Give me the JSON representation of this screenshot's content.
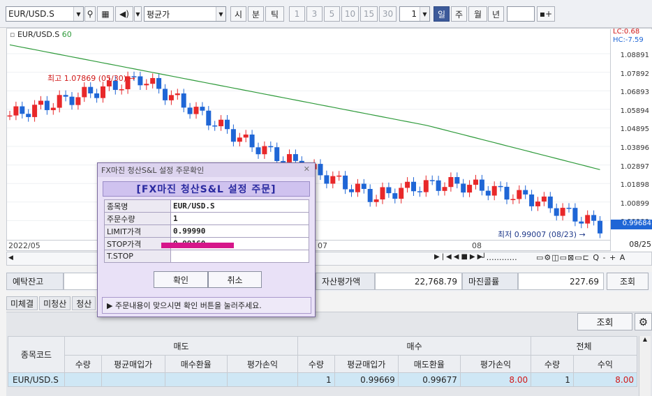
{
  "toolbar": {
    "symbol": "EUR/USD.S",
    "price_type": "평균가",
    "units": [
      "시",
      "분",
      "틱"
    ],
    "intervals": [
      "1",
      "3",
      "5",
      "10",
      "15",
      "30"
    ],
    "interval_count": "1",
    "periods": [
      "일",
      "주",
      "월",
      "년"
    ],
    "period_selected": "일"
  },
  "chart": {
    "legend_symbol": "EUR/USD.S",
    "legend_ma": "60",
    "high_label": "최고 1.07869 (05/30)",
    "low_label": "최저 0.99007 (08/23)",
    "lc": "LC:0.68",
    "hc": "HC:-7.59",
    "price_levels": [
      "1.08891",
      "1.07892",
      "1.06893",
      "1.05894",
      "1.04895",
      "1.03896",
      "1.02897",
      "1.01898",
      "1.00899",
      "0.99900"
    ],
    "current_price": "0.99684",
    "dates": [
      "2022/05",
      "07",
      "08",
      "08/25"
    ],
    "chart_data": {
      "type": "candlestick",
      "series": [
        {
          "name": "60"
        }
      ],
      "ylim": [
        0.99,
        1.09
      ]
    }
  },
  "summary": {
    "deposit_label": "예탁잔고",
    "asset_label": "자산평가액",
    "asset_value": "22,768.79",
    "margin_label": "마진콜률",
    "margin_value": "227.69",
    "query_button": "조회"
  },
  "tabs": [
    "미체결",
    "미청산",
    "청산"
  ],
  "query_button2": "조회",
  "table": {
    "col_code": "종목코드",
    "group_sell": "매도",
    "group_buy": "매수",
    "group_total": "전체",
    "sub": [
      "수량",
      "평균매입가",
      "매수환율",
      "평가손익",
      "수량",
      "평균매입가",
      "매도환율",
      "평가손익",
      "수량",
      "수익"
    ],
    "rows": [
      {
        "code": "EUR/USD.S",
        "cells": [
          "",
          "",
          "",
          "",
          "1",
          "0.99669",
          "0.99677",
          "8.00",
          "1",
          "8.00"
        ]
      }
    ]
  },
  "dialog": {
    "title": "FX마진 청산S&L 설정 주문확인",
    "header": "[FX마진 청산S&L 설정 주문]",
    "fields": [
      {
        "k": "종목명",
        "v": "EUR/USD.S"
      },
      {
        "k": "주문수량",
        "v": "1"
      },
      {
        "k": "LIMIT가격",
        "v": "0.99990"
      },
      {
        "k": "STOP가격",
        "v": "0.99160"
      },
      {
        "k": "T.STOP",
        "v": ""
      }
    ],
    "ok": "확인",
    "cancel": "취소",
    "notice": "주문내용이 맞으시면 확인 버튼을 눌러주세요."
  },
  "colors": {
    "up": "#e8282a",
    "down": "#1f66d6",
    "ma": "#2e9a3a",
    "label_red": "#d01818",
    "dialog_bg": "#e9e1f7"
  }
}
